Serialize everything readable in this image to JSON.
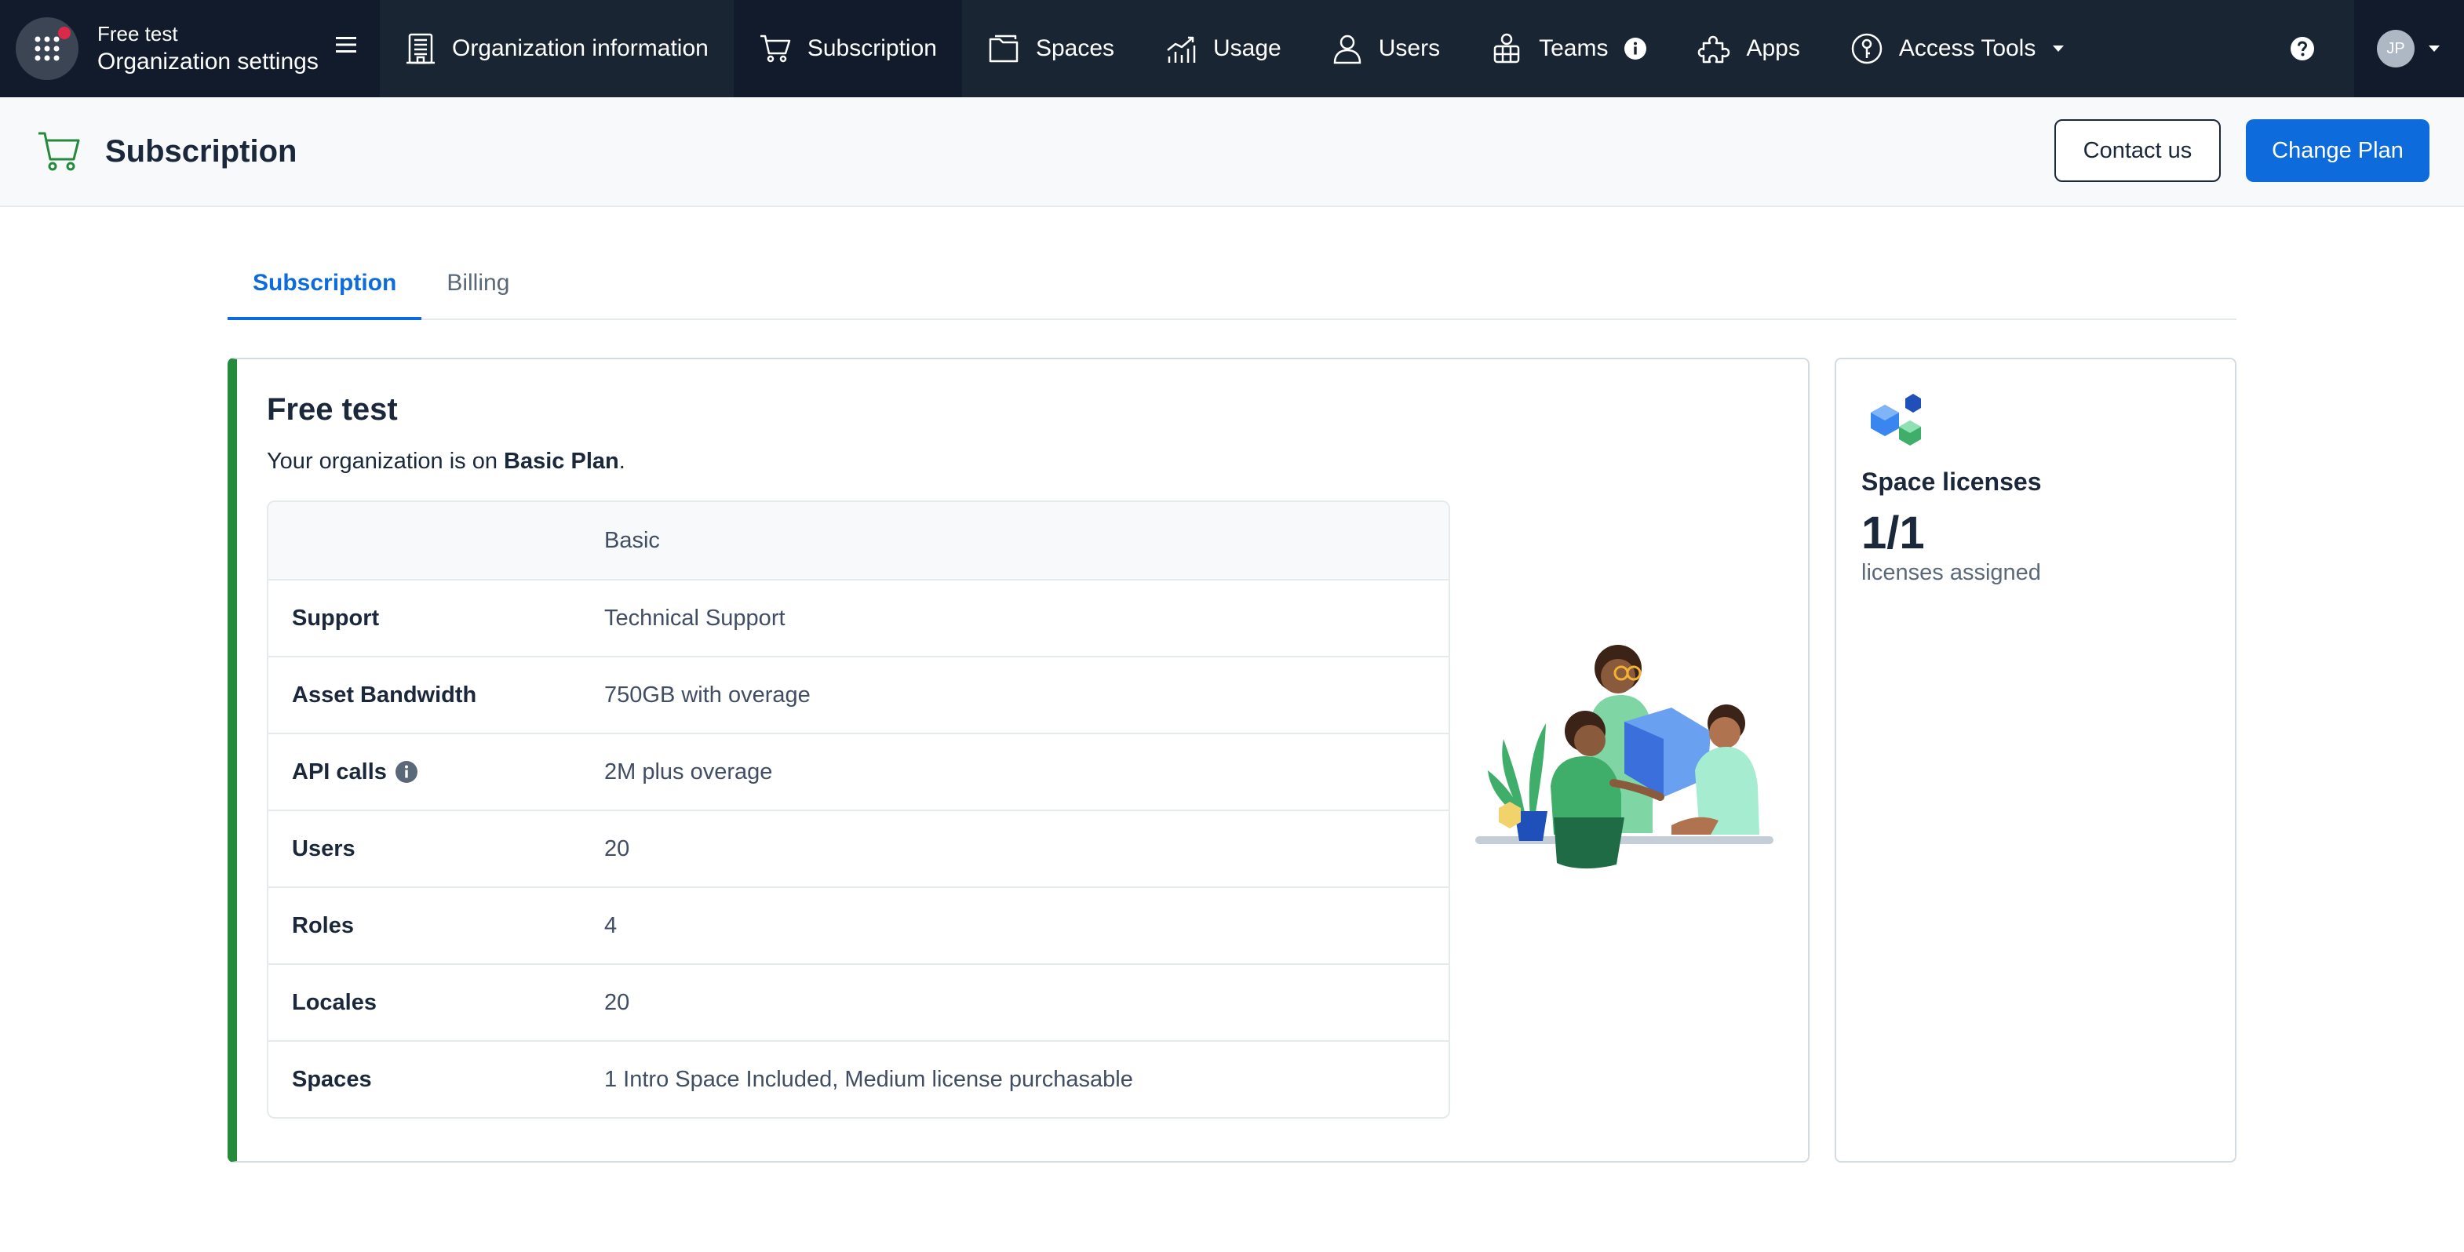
{
  "org": {
    "name": "Free test",
    "section": "Organization settings"
  },
  "nav": {
    "items": [
      {
        "label": "Organization information",
        "icon": "building-icon"
      },
      {
        "label": "Subscription",
        "icon": "cart-icon",
        "active": true
      },
      {
        "label": "Spaces",
        "icon": "folder-icon"
      },
      {
        "label": "Usage",
        "icon": "chart-icon"
      },
      {
        "label": "Users",
        "icon": "user-icon"
      },
      {
        "label": "Teams",
        "icon": "team-icon"
      },
      {
        "label": "Apps",
        "icon": "puzzle-icon"
      },
      {
        "label": "Access Tools",
        "icon": "key-icon"
      }
    ]
  },
  "user": {
    "initials": "JP"
  },
  "header": {
    "title": "Subscription",
    "contact_label": "Contact us",
    "change_plan_label": "Change Plan"
  },
  "tabs": [
    {
      "label": "Subscription",
      "active": true
    },
    {
      "label": "Billing",
      "active": false
    }
  ],
  "plan": {
    "title": "Free test",
    "desc_prefix": "Your organization is on ",
    "plan_name": "Basic Plan",
    "desc_suffix": ".",
    "table_header": "Basic",
    "rows": [
      {
        "label": "Support",
        "value": "Technical Support"
      },
      {
        "label": "Asset Bandwidth",
        "value": "750GB with overage"
      },
      {
        "label": "API calls",
        "value": "2M plus overage"
      },
      {
        "label": "Users",
        "value": "20"
      },
      {
        "label": "Roles",
        "value": "4"
      },
      {
        "label": "Locales",
        "value": "20"
      },
      {
        "label": "Spaces",
        "value": "1 Intro Space Included, Medium license purchasable"
      }
    ]
  },
  "licenses": {
    "title": "Space licenses",
    "count": "1/1",
    "subtitle": "licenses assigned"
  },
  "colors": {
    "nav_bg": "#192532",
    "nav_active_bg": "#111b2b",
    "primary": "#0d6bdb",
    "plan_accent": "#258a3c",
    "notification": "#da294a"
  }
}
